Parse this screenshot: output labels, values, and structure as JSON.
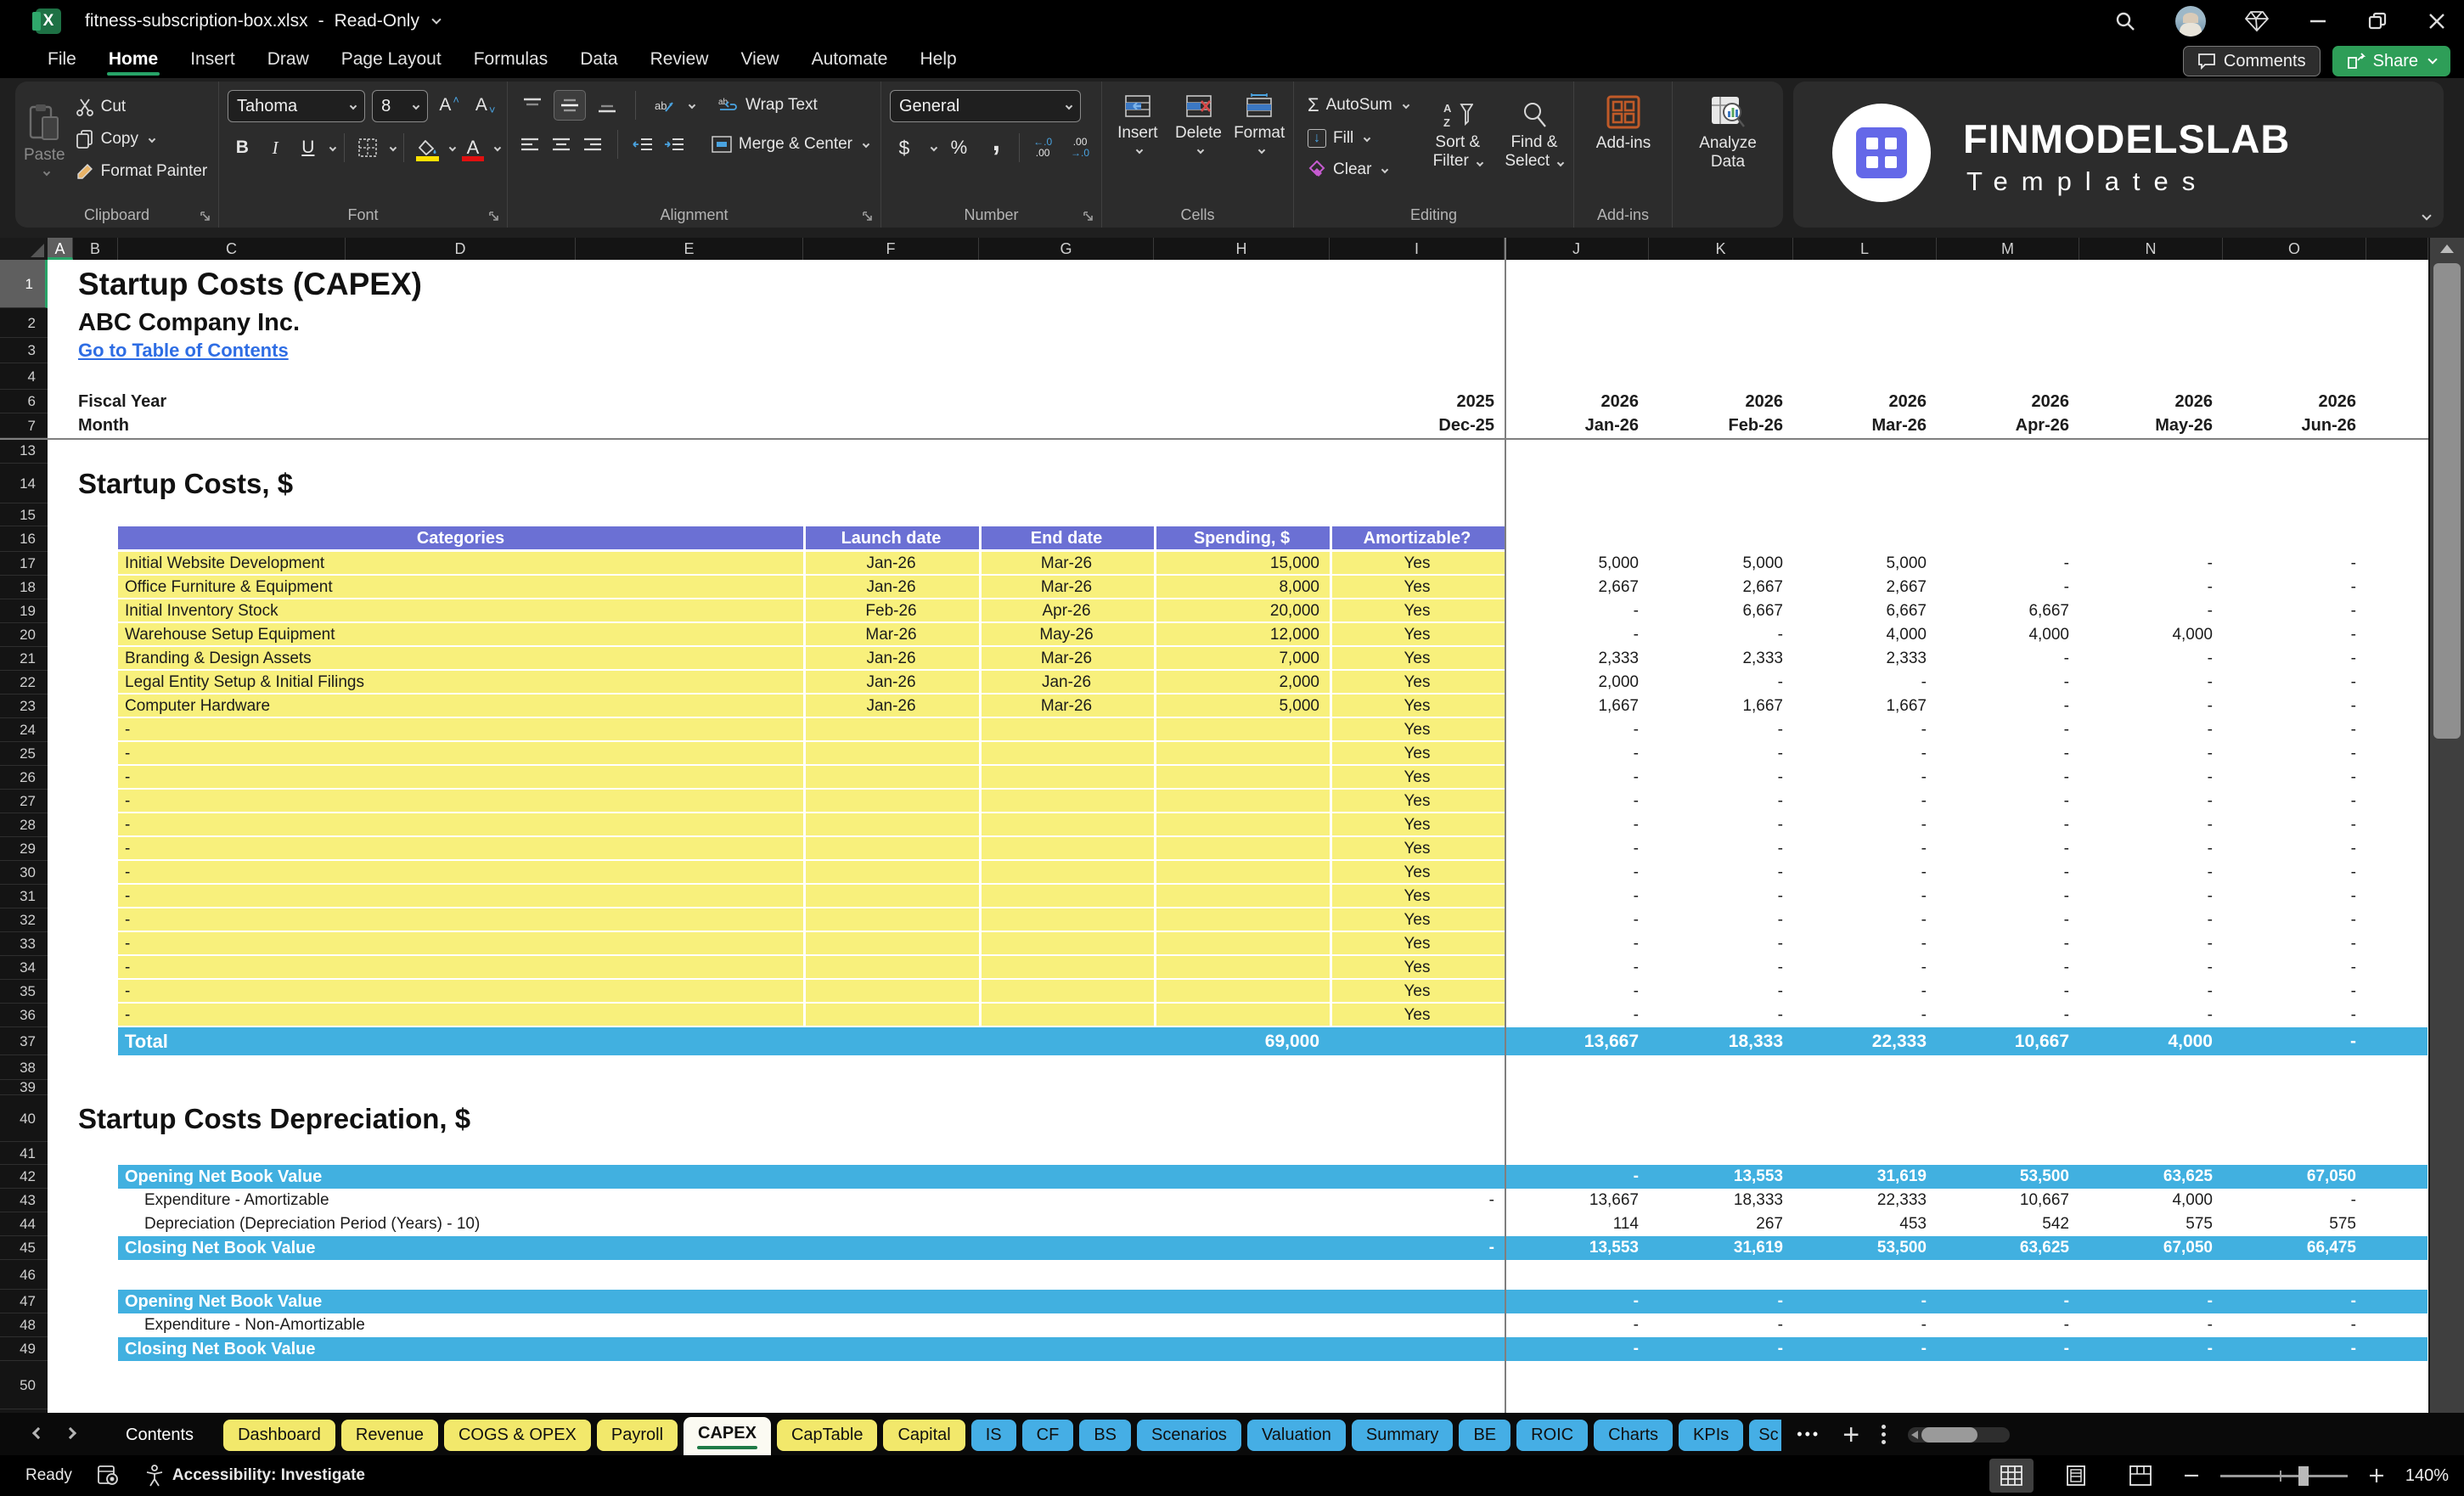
{
  "colors": {
    "accent_green": "#21A366",
    "share_green": "#2E9E58",
    "table_header_purple": "#6B70D4",
    "table_row_yellow": "#F8F07C",
    "band_blue": "#41B0E0",
    "link_blue": "#2E6DE4",
    "tab_yellow": "#F2E86B",
    "tab_blue": "#45AEE5",
    "addins_orange": "#C05A28"
  },
  "titlebar": {
    "filename": "fitness-subscription-box.xlsx",
    "separator": "-",
    "mode": "Read-Only"
  },
  "menu": {
    "items": [
      "File",
      "Home",
      "Insert",
      "Draw",
      "Page Layout",
      "Formulas",
      "Data",
      "Review",
      "View",
      "Automate",
      "Help"
    ],
    "active": "Home"
  },
  "actions": {
    "comments": "Comments",
    "share": "Share"
  },
  "ribbon": {
    "clipboard": {
      "label": "Clipboard",
      "paste": "Paste",
      "cut": "Cut",
      "copy": "Copy",
      "format_painter": "Format Painter"
    },
    "font": {
      "label": "Font",
      "font_name": "Tahoma",
      "font_size": "8",
      "bold": "B",
      "italic": "I",
      "underline": "U"
    },
    "alignment": {
      "label": "Alignment",
      "wrap_text": "Wrap Text",
      "merge_center": "Merge & Center"
    },
    "number": {
      "label": "Number",
      "format": "General",
      "currency": "$",
      "percent": "%",
      "comma": ","
    },
    "cells": {
      "label": "Cells",
      "insert": "Insert",
      "delete": "Delete",
      "format": "Format"
    },
    "editing": {
      "label": "Editing",
      "autosum": "AutoSum",
      "fill": "Fill",
      "clear": "Clear",
      "sort_line1": "Sort &",
      "sort_line2": "Filter",
      "find_line1": "Find &",
      "find_line2": "Select"
    },
    "addins": {
      "label": "Add-ins",
      "addins": "Add-ins",
      "analyze_line1": "Analyze",
      "analyze_line2": "Data"
    }
  },
  "logo": {
    "title": "FINMODELSLAB",
    "subtitle": "Templates"
  },
  "sheet": {
    "columns": [
      "A",
      "B",
      "C",
      "D",
      "E",
      "F",
      "G",
      "H",
      "I",
      "J",
      "K",
      "L",
      "M",
      "N",
      "O"
    ],
    "row_numbers": [
      1,
      2,
      3,
      4,
      6,
      7,
      13,
      14,
      15,
      16,
      17,
      18,
      19,
      20,
      21,
      22,
      23,
      24,
      25,
      26,
      27,
      28,
      29,
      30,
      31,
      32,
      33,
      34,
      35,
      36,
      37,
      38,
      39,
      40,
      41,
      42,
      43,
      44,
      45,
      46,
      47,
      48,
      49,
      50
    ],
    "title": "Startup Costs (CAPEX)",
    "company": "ABC Company Inc.",
    "toc_link": "Go to Table of Contents",
    "fiscal_year_label": "Fiscal Year",
    "month_label": "Month",
    "fiscal_years": [
      "2025",
      "2026",
      "2026",
      "2026",
      "2026",
      "2026",
      "2026"
    ],
    "months": [
      "Dec-25",
      "Jan-26",
      "Feb-26",
      "Mar-26",
      "Apr-26",
      "May-26",
      "Jun-26"
    ],
    "section1_title": "Startup Costs, $",
    "table": {
      "headers": [
        "Categories",
        "Launch date",
        "End date",
        "Spending, $",
        "Amortizable?"
      ],
      "rows": [
        {
          "category": "Initial Website Development",
          "launch": "Jan-26",
          "end": "Mar-26",
          "spending": "15,000",
          "amortizable": "Yes",
          "monthly": [
            "5,000",
            "5,000",
            "5,000",
            "-",
            "-",
            "-"
          ]
        },
        {
          "category": "Office Furniture & Equipment",
          "launch": "Jan-26",
          "end": "Mar-26",
          "spending": "8,000",
          "amortizable": "Yes",
          "monthly": [
            "2,667",
            "2,667",
            "2,667",
            "-",
            "-",
            "-"
          ]
        },
        {
          "category": "Initial Inventory Stock",
          "launch": "Feb-26",
          "end": "Apr-26",
          "spending": "20,000",
          "amortizable": "Yes",
          "monthly": [
            "-",
            "6,667",
            "6,667",
            "6,667",
            "-",
            "-"
          ]
        },
        {
          "category": "Warehouse Setup Equipment",
          "launch": "Mar-26",
          "end": "May-26",
          "spending": "12,000",
          "amortizable": "Yes",
          "monthly": [
            "-",
            "-",
            "4,000",
            "4,000",
            "4,000",
            "-"
          ]
        },
        {
          "category": "Branding & Design Assets",
          "launch": "Jan-26",
          "end": "Mar-26",
          "spending": "7,000",
          "amortizable": "Yes",
          "monthly": [
            "2,333",
            "2,333",
            "2,333",
            "-",
            "-",
            "-"
          ]
        },
        {
          "category": "Legal Entity Setup & Initial Filings",
          "launch": "Jan-26",
          "end": "Jan-26",
          "spending": "2,000",
          "amortizable": "Yes",
          "monthly": [
            "2,000",
            "-",
            "-",
            "-",
            "-",
            "-"
          ]
        },
        {
          "category": "Computer Hardware",
          "launch": "Jan-26",
          "end": "Mar-26",
          "spending": "5,000",
          "amortizable": "Yes",
          "monthly": [
            "1,667",
            "1,667",
            "1,667",
            "-",
            "-",
            "-"
          ]
        },
        {
          "category": "-",
          "launch": "",
          "end": "",
          "spending": "",
          "amortizable": "Yes",
          "monthly": [
            "-",
            "-",
            "-",
            "-",
            "-",
            "-"
          ]
        },
        {
          "category": "-",
          "launch": "",
          "end": "",
          "spending": "",
          "amortizable": "Yes",
          "monthly": [
            "-",
            "-",
            "-",
            "-",
            "-",
            "-"
          ]
        },
        {
          "category": "-",
          "launch": "",
          "end": "",
          "spending": "",
          "amortizable": "Yes",
          "monthly": [
            "-",
            "-",
            "-",
            "-",
            "-",
            "-"
          ]
        },
        {
          "category": "-",
          "launch": "",
          "end": "",
          "spending": "",
          "amortizable": "Yes",
          "monthly": [
            "-",
            "-",
            "-",
            "-",
            "-",
            "-"
          ]
        },
        {
          "category": "-",
          "launch": "",
          "end": "",
          "spending": "",
          "amortizable": "Yes",
          "monthly": [
            "-",
            "-",
            "-",
            "-",
            "-",
            "-"
          ]
        },
        {
          "category": "-",
          "launch": "",
          "end": "",
          "spending": "",
          "amortizable": "Yes",
          "monthly": [
            "-",
            "-",
            "-",
            "-",
            "-",
            "-"
          ]
        },
        {
          "category": "-",
          "launch": "",
          "end": "",
          "spending": "",
          "amortizable": "Yes",
          "monthly": [
            "-",
            "-",
            "-",
            "-",
            "-",
            "-"
          ]
        },
        {
          "category": "-",
          "launch": "",
          "end": "",
          "spending": "",
          "amortizable": "Yes",
          "monthly": [
            "-",
            "-",
            "-",
            "-",
            "-",
            "-"
          ]
        },
        {
          "category": "-",
          "launch": "",
          "end": "",
          "spending": "",
          "amortizable": "Yes",
          "monthly": [
            "-",
            "-",
            "-",
            "-",
            "-",
            "-"
          ]
        },
        {
          "category": "-",
          "launch": "",
          "end": "",
          "spending": "",
          "amortizable": "Yes",
          "monthly": [
            "-",
            "-",
            "-",
            "-",
            "-",
            "-"
          ]
        },
        {
          "category": "-",
          "launch": "",
          "end": "",
          "spending": "",
          "amortizable": "Yes",
          "monthly": [
            "-",
            "-",
            "-",
            "-",
            "-",
            "-"
          ]
        },
        {
          "category": "-",
          "launch": "",
          "end": "",
          "spending": "",
          "amortizable": "Yes",
          "monthly": [
            "-",
            "-",
            "-",
            "-",
            "-",
            "-"
          ]
        },
        {
          "category": "-",
          "launch": "",
          "end": "",
          "spending": "",
          "amortizable": "Yes",
          "monthly": [
            "-",
            "-",
            "-",
            "-",
            "-",
            "-"
          ]
        }
      ],
      "total_label": "Total",
      "total_spending": "69,000",
      "total_monthly": [
        "13,667",
        "18,333",
        "22,333",
        "10,667",
        "4,000",
        "-"
      ]
    },
    "section2_title": "Startup Costs Depreciation, $",
    "depreciation_amortizable": [
      {
        "label": "Opening Net Book Value",
        "band": true,
        "dec": "",
        "values": [
          "-",
          "13,553",
          "31,619",
          "53,500",
          "63,625",
          "67,050"
        ]
      },
      {
        "label": "Expenditure - Amortizable",
        "band": false,
        "dec": "-",
        "values": [
          "13,667",
          "18,333",
          "22,333",
          "10,667",
          "4,000",
          "-"
        ]
      },
      {
        "label": "Depreciation (Depreciation Period (Years) - 10)",
        "band": false,
        "dec": "",
        "values": [
          "114",
          "267",
          "453",
          "542",
          "575",
          "575"
        ]
      },
      {
        "label": "Closing Net Book Value",
        "band": true,
        "dec": "-",
        "values": [
          "13,553",
          "31,619",
          "53,500",
          "63,625",
          "67,050",
          "66,475"
        ]
      }
    ],
    "depreciation_non_amortizable": [
      {
        "label": "Opening Net Book Value",
        "band": true,
        "dec": "",
        "values": [
          "-",
          "-",
          "-",
          "-",
          "-",
          "-"
        ]
      },
      {
        "label": "Expenditure - Non-Amortizable",
        "band": false,
        "dec": "",
        "values": [
          "-",
          "-",
          "-",
          "-",
          "-",
          "-"
        ]
      },
      {
        "label": "Closing Net Book Value",
        "band": true,
        "dec": "",
        "values": [
          "-",
          "-",
          "-",
          "-",
          "-",
          "-"
        ]
      }
    ]
  },
  "tabs": {
    "sheets": [
      {
        "label": "Contents",
        "type": "plain"
      },
      {
        "label": "Dashboard",
        "type": "yellow"
      },
      {
        "label": "Revenue",
        "type": "yellow"
      },
      {
        "label": "COGS & OPEX",
        "type": "yellow"
      },
      {
        "label": "Payroll",
        "type": "yellow"
      },
      {
        "label": "CAPEX",
        "type": "active"
      },
      {
        "label": "CapTable",
        "type": "yellow"
      },
      {
        "label": "Capital",
        "type": "yellow"
      },
      {
        "label": "IS",
        "type": "blue"
      },
      {
        "label": "CF",
        "type": "blue"
      },
      {
        "label": "BS",
        "type": "blue"
      },
      {
        "label": "Scenarios",
        "type": "blue"
      },
      {
        "label": "Valuation",
        "type": "blue"
      },
      {
        "label": "Summary",
        "type": "blue"
      },
      {
        "label": "BE",
        "type": "blue"
      },
      {
        "label": "ROIC",
        "type": "blue"
      },
      {
        "label": "Charts",
        "type": "blue"
      },
      {
        "label": "KPIs",
        "type": "blue"
      },
      {
        "label": "Sc",
        "type": "blue-truncated"
      }
    ],
    "overflow": "•••"
  },
  "statusbar": {
    "ready": "Ready",
    "accessibility": "Accessibility: Investigate",
    "zoom_level": "140%"
  }
}
